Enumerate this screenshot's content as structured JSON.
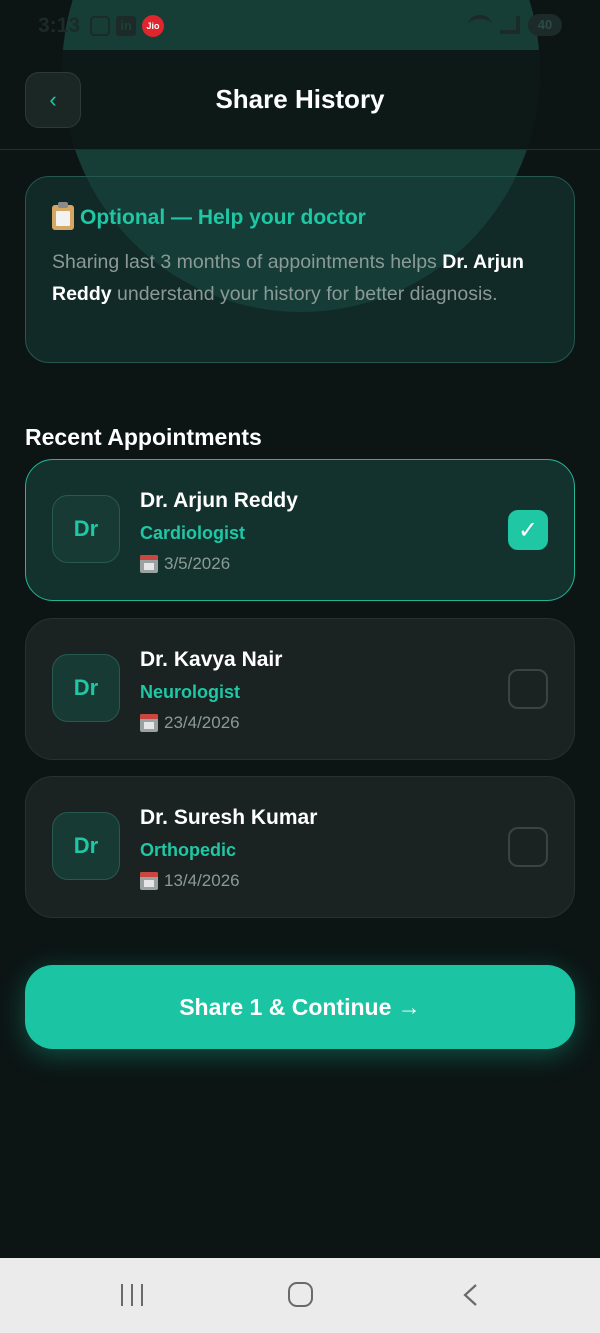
{
  "status_bar": {
    "time": "3:13",
    "carrier_badge": "Jio",
    "linkedin_badge": "in",
    "battery": "40",
    "icons": [
      "screenshot-icon",
      "linkedin-icon",
      "jio-icon",
      "wifi-icon",
      "signal-icon",
      "battery-icon"
    ]
  },
  "header": {
    "back_label": "‹",
    "title": "Share History"
  },
  "info_card": {
    "title": "Optional — Help your doctor",
    "text_before": "Sharing last 3 months of appointments helps ",
    "highlight_name": "Dr. Arjun Reddy",
    "text_after": " understand your history for better diagnosis.",
    "icon": "clipboard-icon"
  },
  "section": {
    "title": "Recent Appointments"
  },
  "appointments": [
    {
      "avatar": "Dr",
      "name": "Dr. Arjun Reddy",
      "specialty": "Cardiologist",
      "date": "3/5/2026",
      "selected": true,
      "check": "✓"
    },
    {
      "avatar": "Dr",
      "name": "Dr. Kavya Nair",
      "specialty": "Neurologist",
      "date": "23/4/2026",
      "selected": false,
      "check": ""
    },
    {
      "avatar": "Dr",
      "name": "Dr. Suresh Kumar",
      "specialty": "Orthopedic",
      "date": "13/4/2026",
      "selected": false,
      "check": ""
    }
  ],
  "primary_button": {
    "label": "Share 1 & Continue →"
  },
  "colors": {
    "background": "#0c1514",
    "accent": "#1fc7a5",
    "card": "#1a2322",
    "selected_card": "#14322d",
    "muted_text": "#8b9a97"
  },
  "nav_bar": {
    "icons": [
      "recents-icon",
      "home-icon",
      "back-nav-icon"
    ]
  }
}
